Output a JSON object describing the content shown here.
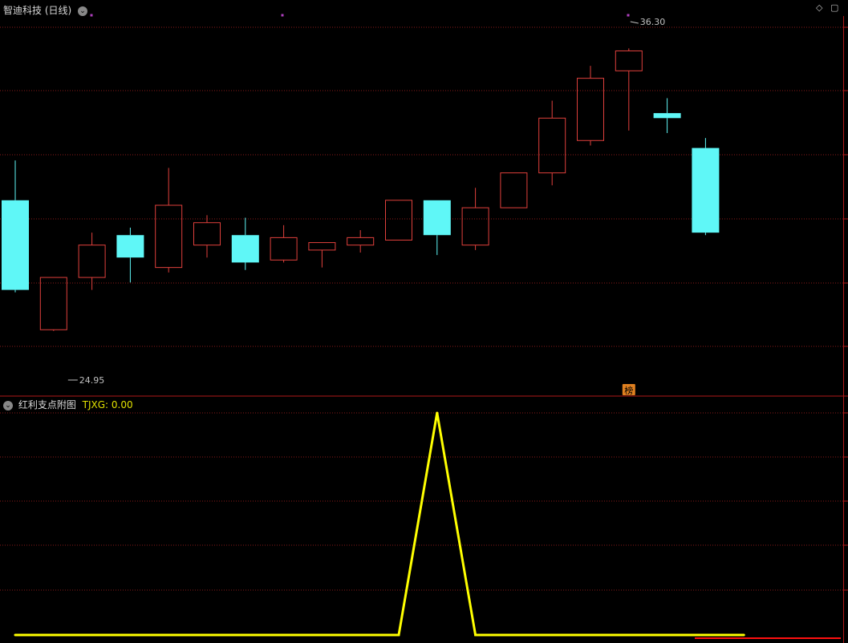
{
  "header": {
    "stock_title": "智迪科技 (日线)",
    "indicator_title": "红利支点附图",
    "indicator_value_label": "TJXG: 0.00"
  },
  "colors": {
    "background": "#000000",
    "up": "#e0403c",
    "down": "#5ff7f7",
    "grid": "#8a1a1a",
    "indicator_line": "#ffff00",
    "annotation": "#c0c0c0",
    "marker": "#b040c0",
    "badge": "#e08020"
  },
  "chart_data": [
    {
      "type": "candlestick",
      "title": "智迪科技 (日线)",
      "ylim": [
        22.4,
        37.6
      ],
      "candles": [
        {
          "open": 30.2,
          "close": 26.6,
          "high": 31.8,
          "low": 26.5
        },
        {
          "open": 25.0,
          "close": 27.1,
          "high": 27.1,
          "low": 24.95
        },
        {
          "open": 27.1,
          "close": 28.4,
          "high": 28.9,
          "low": 26.6
        },
        {
          "open": 28.8,
          "close": 27.9,
          "high": 29.1,
          "low": 26.9
        },
        {
          "open": 27.5,
          "close": 30.0,
          "high": 31.5,
          "low": 27.3
        },
        {
          "open": 28.4,
          "close": 29.3,
          "high": 29.6,
          "low": 27.9
        },
        {
          "open": 28.8,
          "close": 27.7,
          "high": 29.5,
          "low": 27.4
        },
        {
          "open": 27.8,
          "close": 28.7,
          "high": 29.2,
          "low": 27.7
        },
        {
          "open": 28.2,
          "close": 28.5,
          "high": 28.5,
          "low": 27.5
        },
        {
          "open": 28.4,
          "close": 28.7,
          "high": 29.0,
          "low": 28.1
        },
        {
          "open": 28.6,
          "close": 30.2,
          "high": 30.2,
          "low": 28.6
        },
        {
          "open": 30.2,
          "close": 28.8,
          "high": 30.2,
          "low": 28.0
        },
        {
          "open": 28.4,
          "close": 29.9,
          "high": 30.7,
          "low": 28.2
        },
        {
          "open": 29.9,
          "close": 31.3,
          "high": 31.3,
          "low": 29.9
        },
        {
          "open": 31.3,
          "close": 33.5,
          "high": 34.2,
          "low": 30.8
        },
        {
          "open": 32.6,
          "close": 35.1,
          "high": 35.6,
          "low": 32.4
        },
        {
          "open": 35.4,
          "close": 36.2,
          "high": 36.3,
          "low": 33.0
        },
        {
          "open": 33.7,
          "close": 33.5,
          "high": 34.3,
          "low": 32.9
        },
        {
          "open": 32.3,
          "close": 28.9,
          "high": 32.7,
          "low": 28.8
        }
      ],
      "annotations": [
        {
          "label": "36.30",
          "index": 16,
          "value": 36.3
        },
        {
          "label": "24.95",
          "index": 1,
          "value": 24.95
        }
      ],
      "badge": {
        "label": "榜",
        "index": 16
      },
      "grid": true
    },
    {
      "type": "line",
      "title": "红利支点附图",
      "series": [
        {
          "name": "TJXG",
          "values": [
            0,
            0,
            0,
            0,
            0,
            0,
            0,
            0,
            0,
            0,
            0,
            1,
            0,
            0,
            0,
            0,
            0,
            0,
            0,
            0
          ]
        }
      ],
      "ylim": [
        0,
        1
      ],
      "grid": true
    }
  ]
}
